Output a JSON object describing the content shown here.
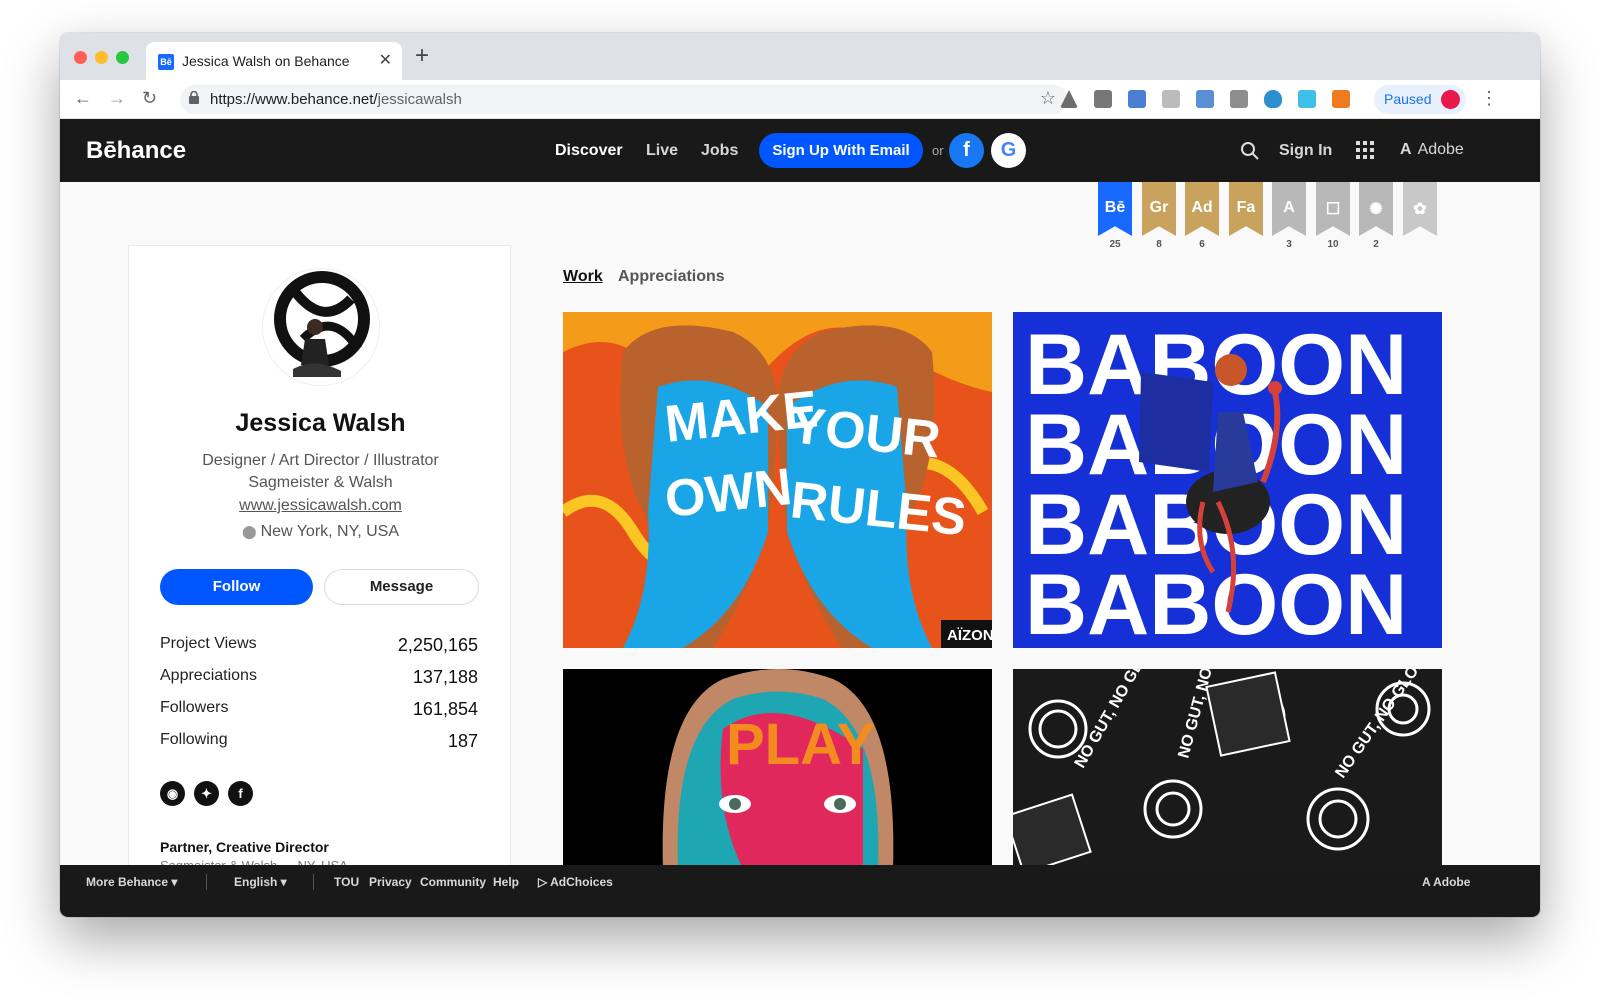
{
  "browser": {
    "tab_title": "Jessica Walsh on Behance",
    "tab_favicon": "Bē",
    "url_host": "https://www.behance.net/",
    "url_path": "jessicawalsh",
    "profile_status": "Paused"
  },
  "nav": {
    "logo": "Bēhance",
    "discover": "Discover",
    "live": "Live",
    "jobs": "Jobs",
    "signup": "Sign Up With Email",
    "or": "or",
    "facebook": "f",
    "google": "G",
    "sign_in": "Sign In",
    "adobe": "Adobe",
    "adobe_mark": "A"
  },
  "badges": [
    {
      "label": "Bē",
      "count": "25",
      "color": "#1769ff"
    },
    {
      "label": "Gr",
      "count": "8",
      "color": "#c9a35d"
    },
    {
      "label": "Ad",
      "count": "6",
      "color": "#c9a35d"
    },
    {
      "label": "Fa",
      "count": "",
      "color": "#c9a35d"
    },
    {
      "label": "A",
      "count": "3",
      "color": "#b8b8b8"
    },
    {
      "label": "☐",
      "count": "10",
      "color": "#b8b8b8"
    },
    {
      "label": "✺",
      "count": "2",
      "color": "#b8b8b8"
    },
    {
      "label": "✿",
      "count": "",
      "color": "#c8c8c8"
    }
  ],
  "profile": {
    "name": "Jessica Walsh",
    "occupation": "Designer / Art Director / Illustrator",
    "company": "Sagmeister & Walsh",
    "website": "www.jessicawalsh.com",
    "location": "New York, NY, USA",
    "follow": "Follow",
    "message": "Message",
    "stats": [
      {
        "label": "Project Views",
        "value": "2,250,165"
      },
      {
        "label": "Appreciations",
        "value": "137,188"
      },
      {
        "label": "Followers",
        "value": "161,854"
      },
      {
        "label": "Following",
        "value": "187"
      }
    ],
    "social": [
      "instagram-icon",
      "twitter-icon",
      "facebook-icon"
    ],
    "job_title": "Partner, Creative Director",
    "job_sub": "Sagmeister & Walsh — NY, USA"
  },
  "work": {
    "tab_work": "Work",
    "tab_appreciations": "Appreciations",
    "projects": [
      {
        "text": "MAKE YOUR OWN RULES",
        "badge": "AÏZON"
      },
      {
        "text": "BABOON",
        "badge": ""
      },
      {
        "text": "PLAY",
        "badge": ""
      },
      {
        "text": "NO GUT, NO GLORY",
        "badge": ""
      }
    ]
  },
  "footer": {
    "more": "More Behance ▾",
    "language": "English ▾",
    "tou": "TOU",
    "privacy": "Privacy",
    "community": "Community",
    "help": "Help",
    "adchoices": "AdChoices",
    "adobe": "Adobe"
  }
}
